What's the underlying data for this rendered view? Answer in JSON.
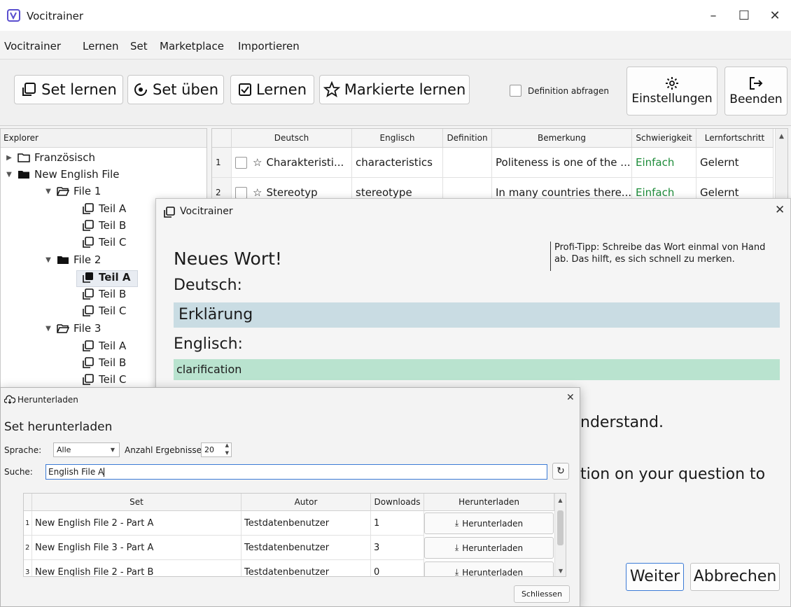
{
  "window": {
    "title": "Vocitrainer"
  },
  "menu": [
    "Vocitrainer",
    "Lernen",
    "Set",
    "Marketplace",
    "Importieren"
  ],
  "toolbar": {
    "set_lernen": "Set lernen",
    "set_ueben": "Set üben",
    "lernen": "Lernen",
    "markierte_lernen": "Markierte lernen",
    "definition_abfragen": "Definition abfragen",
    "einstellungen": "Einstellungen",
    "beenden": "Beenden"
  },
  "explorer": {
    "header": "Explorer",
    "items": [
      {
        "label": "Französisch"
      },
      {
        "label": "New English File"
      },
      {
        "label": "File 1"
      },
      {
        "label": "Teil A"
      },
      {
        "label": "Teil B"
      },
      {
        "label": "Teil C"
      },
      {
        "label": "File 2"
      },
      {
        "label": "Teil A"
      },
      {
        "label": "Teil B"
      },
      {
        "label": "Teil C"
      },
      {
        "label": "File 3"
      },
      {
        "label": "Teil A"
      },
      {
        "label": "Teil B"
      },
      {
        "label": "Teil C"
      }
    ]
  },
  "vocab_table": {
    "columns": [
      "Deutsch",
      "Englisch",
      "Definition",
      "Bemerkung",
      "Schwierigkeit",
      "Lernfortschritt"
    ],
    "rows": [
      {
        "num": "1",
        "deutsch": "Charakteristi...",
        "englisch": "characteristics",
        "definition": "",
        "bemerkung": "Politeness is one of the ...",
        "schwierigkeit": "Einfach",
        "fortschritt": "Gelernt"
      },
      {
        "num": "2",
        "deutsch": "Stereotyp",
        "englisch": "stereotype",
        "definition": "",
        "bemerkung": "In many countries there...",
        "schwierigkeit": "Einfach",
        "fortschritt": "Gelernt"
      }
    ]
  },
  "learn_dialog": {
    "title": "Vocitrainer",
    "heading": "Neues Wort!",
    "tip": "Profi-Tipp: Schreibe das Wort einmal von Hand ab. Das hilft, es sich schnell zu merken.",
    "source_label": "Deutsch:",
    "source_word": "Erklärung",
    "target_label": "Englisch:",
    "target_word": "clarification",
    "example_line1": "nderstand.",
    "example_line2": "tion on your question to",
    "weiter": "Weiter",
    "abbrechen": "Abbrechen"
  },
  "download_dialog": {
    "title": "Herunterladen",
    "heading": "Set herunterladen",
    "sprache_label": "Sprache:",
    "sprache_value": "Alle",
    "anzahl_label": "Anzahl Ergebnisse:",
    "anzahl_value": "20",
    "suche_label": "Suche:",
    "suche_value": "English File A",
    "columns": [
      "Set",
      "Autor",
      "Downloads",
      "Herunterladen"
    ],
    "rows": [
      {
        "num": "1",
        "set": "New English File 2 - Part A",
        "autor": "Testdatenbenutzer",
        "downloads": "1",
        "action": "Herunterladen"
      },
      {
        "num": "2",
        "set": "New English File 3 - Part A",
        "autor": "Testdatenbenutzer",
        "downloads": "3",
        "action": "Herunterladen"
      },
      {
        "num": "3",
        "set": "New English File 2 - Part B",
        "autor": "Testdatenbenutzer",
        "downloads": "0",
        "action": "Herunterladen"
      }
    ],
    "schliessen": "Schliessen"
  },
  "colors": {
    "easy_green": "#1e8c3a",
    "source_bar": "#c9dce3",
    "target_bar": "#b9e3cf",
    "accent_border": "#3c7bd6"
  }
}
